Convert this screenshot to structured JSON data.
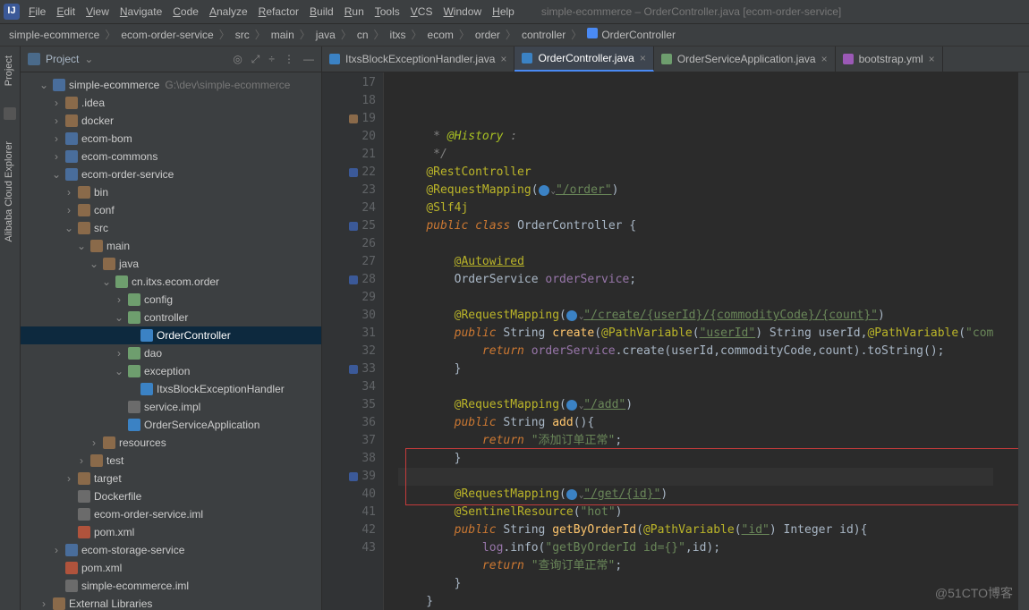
{
  "title": "simple-ecommerce – OrderController.java [ecom-order-service]",
  "menus": [
    "File",
    "Edit",
    "View",
    "Navigate",
    "Code",
    "Analyze",
    "Refactor",
    "Build",
    "Run",
    "Tools",
    "VCS",
    "Window",
    "Help"
  ],
  "crumbs": [
    "simple-ecommerce",
    "ecom-order-service",
    "src",
    "main",
    "java",
    "cn",
    "itxs",
    "ecom",
    "order",
    "controller",
    "OrderController"
  ],
  "toolstrip": {
    "project": "Project",
    "cloud": "Alibaba Cloud Explorer"
  },
  "sidebar": {
    "title": "Project"
  },
  "tree": {
    "root": "simple-ecommerce",
    "rootPath": "G:\\dev\\simple-ecommerce",
    "items": [
      {
        "d": 1,
        "t": "v",
        "i": "mod",
        "l": "simple-ecommerce",
        "extra": "G:\\dev\\simple-ecommerce"
      },
      {
        "d": 2,
        "t": ">",
        "i": "fold",
        "l": ".idea"
      },
      {
        "d": 2,
        "t": ">",
        "i": "fold",
        "l": "docker"
      },
      {
        "d": 2,
        "t": ">",
        "i": "mod",
        "l": "ecom-bom"
      },
      {
        "d": 2,
        "t": ">",
        "i": "mod",
        "l": "ecom-commons"
      },
      {
        "d": 2,
        "t": "v",
        "i": "mod",
        "l": "ecom-order-service"
      },
      {
        "d": 3,
        "t": ">",
        "i": "fold",
        "l": "bin"
      },
      {
        "d": 3,
        "t": ">",
        "i": "fold",
        "l": "conf"
      },
      {
        "d": 3,
        "t": "v",
        "i": "fold",
        "l": "src"
      },
      {
        "d": 4,
        "t": "v",
        "i": "fold",
        "l": "main"
      },
      {
        "d": 5,
        "t": "v",
        "i": "fold",
        "l": "java"
      },
      {
        "d": 6,
        "t": "v",
        "i": "pkg",
        "l": "cn.itxs.ecom.order"
      },
      {
        "d": 7,
        "t": ">",
        "i": "pkg",
        "l": "config"
      },
      {
        "d": 7,
        "t": "v",
        "i": "pkg",
        "l": "controller"
      },
      {
        "d": 8,
        "t": " ",
        "i": "cls",
        "l": "OrderController",
        "sel": true
      },
      {
        "d": 7,
        "t": ">",
        "i": "pkg",
        "l": "dao"
      },
      {
        "d": 7,
        "t": "v",
        "i": "pkg",
        "l": "exception"
      },
      {
        "d": 8,
        "t": " ",
        "i": "cls",
        "l": "ItxsBlockExceptionHandler"
      },
      {
        "d": 7,
        "t": " ",
        "i": "file",
        "l": "service.impl"
      },
      {
        "d": 7,
        "t": " ",
        "i": "cls",
        "l": "OrderServiceApplication"
      },
      {
        "d": 5,
        "t": ">",
        "i": "fold",
        "l": "resources"
      },
      {
        "d": 4,
        "t": ">",
        "i": "fold",
        "l": "test"
      },
      {
        "d": 3,
        "t": ">",
        "i": "fold",
        "l": "target"
      },
      {
        "d": 3,
        "t": " ",
        "i": "file",
        "l": "Dockerfile"
      },
      {
        "d": 3,
        "t": " ",
        "i": "file",
        "l": "ecom-order-service.iml"
      },
      {
        "d": 3,
        "t": " ",
        "i": "xml",
        "l": "pom.xml"
      },
      {
        "d": 2,
        "t": ">",
        "i": "mod",
        "l": "ecom-storage-service"
      },
      {
        "d": 2,
        "t": " ",
        "i": "xml",
        "l": "pom.xml"
      },
      {
        "d": 2,
        "t": " ",
        "i": "file",
        "l": "simple-ecommerce.iml"
      },
      {
        "d": 1,
        "t": ">",
        "i": "fold",
        "l": "External Libraries"
      }
    ]
  },
  "tabs": [
    {
      "label": "ItxsBlockExceptionHandler.java",
      "color": "#3b82c4"
    },
    {
      "label": "OrderController.java",
      "color": "#3b82c4",
      "active": true
    },
    {
      "label": "OrderServiceApplication.java",
      "color": "#6e9e6e"
    },
    {
      "label": "bootstrap.yml",
      "color": "#9b59b6"
    }
  ],
  "code": {
    "start": 17,
    "lines": [
      {
        "n": 17,
        "html": "     <span class='cmt'>* </span><span class='tag'>@History</span><span class='cmt'> :</span>"
      },
      {
        "n": 18,
        "html": "     <span class='cmt'>*/</span>"
      },
      {
        "n": 19,
        "gut": "run",
        "html": "    <span class='ann'>@RestController</span>"
      },
      {
        "n": 20,
        "html": "    <span class='ann'>@RequestMapping</span>(<span class='globe'></span><span class='dnarr'>⌄</span><span class='strund'>\"/order\"</span>)"
      },
      {
        "n": 21,
        "html": "    <span class='ann'>@Slf4j</span>"
      },
      {
        "n": 22,
        "gut": "impl",
        "html": "    <span class='kw'>public</span> <span class='kw'>class</span> <span class='typ'>OrderController</span> {"
      },
      {
        "n": 23,
        "html": ""
      },
      {
        "n": 24,
        "html": "        <span class='ann'><u>@Autowired</u></span>"
      },
      {
        "n": 25,
        "gut": "impl",
        "html": "        <span class='typ'>OrderService</span> <span class='fld'>orderService</span>;"
      },
      {
        "n": 26,
        "html": ""
      },
      {
        "n": 27,
        "html": "        <span class='ann'>@RequestMapping</span>(<span class='globe'></span><span class='dnarr'>⌄</span><span class='strund'>\"/create/{userId}/{commodityCode}/{count}\"</span>)"
      },
      {
        "n": 28,
        "gut": "impl",
        "html": "        <span class='kw'>public</span> <span class='typ'>String</span> <span class='id'>create</span>(<span class='ann'>@PathVariable</span>(<span class='strund'>\"userId\"</span>) <span class='typ'>String</span> userId,<span class='ann'>@PathVariable</span>(<span class='str'>\"com</span>"
      },
      {
        "n": 29,
        "html": "            <span class='kw'>return</span> <span class='fld'>orderService</span>.create(userId,commodityCode,count).toString();"
      },
      {
        "n": 30,
        "html": "        }"
      },
      {
        "n": 31,
        "html": ""
      },
      {
        "n": 32,
        "html": "        <span class='ann'>@RequestMapping</span>(<span class='globe'></span><span class='dnarr'>⌄</span><span class='strund'>\"/add\"</span>)"
      },
      {
        "n": 33,
        "gut": "impl",
        "html": "        <span class='kw'>public</span> <span class='typ'>String</span> <span class='id'>add</span>(){"
      },
      {
        "n": 34,
        "html": "            <span class='kw'>return</span> <span class='str'>\"添加订单正常\"</span>;"
      },
      {
        "n": 35,
        "html": "        }"
      },
      {
        "n": 36,
        "hl": true,
        "html": ""
      },
      {
        "n": 37,
        "html": "        <span class='ann'>@RequestMapping</span>(<span class='globe'></span><span class='dnarr'>⌄</span><span class='strund'>\"/get/{id}\"</span>)"
      },
      {
        "n": 38,
        "html": "        <span class='ann'>@SentinelResource</span>(<span class='str'>\"hot\"</span>)"
      },
      {
        "n": 39,
        "gut": "impl",
        "html": "        <span class='kw'>public</span> <span class='typ'>String</span> <span class='id'>getByOrderId</span>(<span class='ann'>@PathVariable</span>(<span class='strund'>\"id\"</span>) <span class='typ'>Integer</span> id){"
      },
      {
        "n": 40,
        "html": "            <span class='fld'>log</span>.info(<span class='str'>\"getByOrderId id={}\"</span>,id);"
      },
      {
        "n": 41,
        "html": "            <span class='kw'>return</span> <span class='str'>\"查询订单正常\"</span>;"
      },
      {
        "n": 42,
        "html": "        }"
      },
      {
        "n": 43,
        "html": "    }"
      }
    ]
  },
  "watermark": "@51CTO博客"
}
